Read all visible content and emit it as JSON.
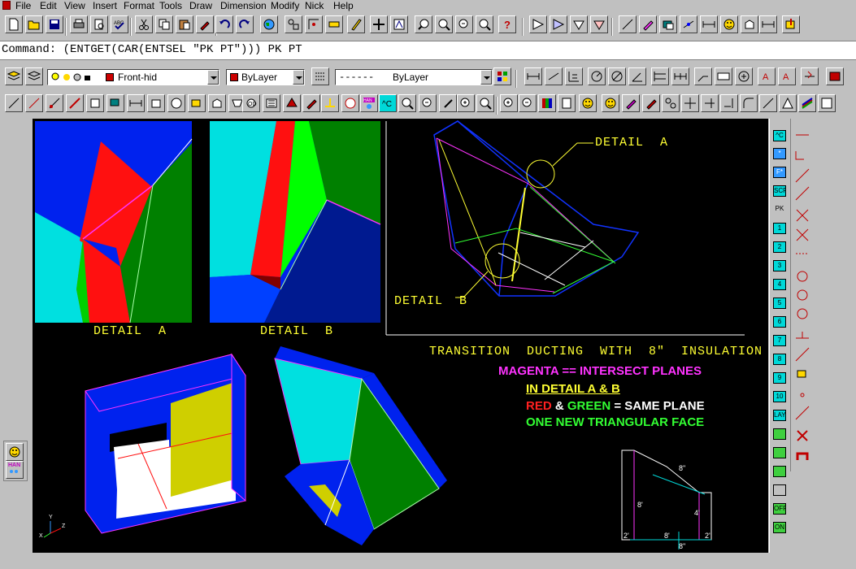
{
  "menu": [
    "File",
    "Edit",
    "View",
    "Insert",
    "Format",
    "Tools",
    "Draw",
    "Dimension",
    "Modify",
    "Nick",
    "Help"
  ],
  "command_line": "Command: (ENTGET(CAR(ENTSEL \"PK PT\"))) PK PT",
  "layer": {
    "name": "Front-hid",
    "color": "#cc0000"
  },
  "color_combo": {
    "value": "ByLayer",
    "color": "#cc0000"
  },
  "linetype_combo": {
    "pattern": "------",
    "value": "ByLayer"
  },
  "drawing": {
    "detail_a_caption": "DETAIL  A",
    "detail_b_caption": "DETAIL  B",
    "callout_a": "DETAIL  A",
    "callout_b": "DETAIL  B",
    "title": "TRANSITION  DUCTING  WITH  8\"  INSULATION",
    "note1": "MAGENTA == INTERSECT PLANES",
    "note2": "IN DETAIL A & B",
    "note3_red": "RED",
    "note3_amp": " & ",
    "note3_green": "GREEN",
    "note3_rest": " = SAME PLANE",
    "note4": "ONE NEW TRIANGULAR FACE",
    "dims": {
      "top": "8\"",
      "left": "8'",
      "right": "4'",
      "bl": "2'",
      "bm": "8'",
      "br": "2'",
      "bottom": "8\""
    },
    "ucs": {
      "x": "X",
      "y": "Y",
      "z": "Z"
    },
    "colors": {
      "yellow": "#ffff33",
      "magenta": "#ff33ff",
      "red": "#ff2020",
      "green": "#33ff33",
      "white": "#ffffff"
    }
  },
  "right_palette": [
    "^C",
    "*",
    "F*",
    "SCR",
    "PK",
    "1",
    "2",
    "3",
    "4",
    "5",
    "6",
    "7",
    "8",
    "9",
    "10",
    "LAY",
    "",
    "",
    "",
    "",
    "OFF",
    "ON"
  ],
  "left_float": [
    "HAN"
  ]
}
